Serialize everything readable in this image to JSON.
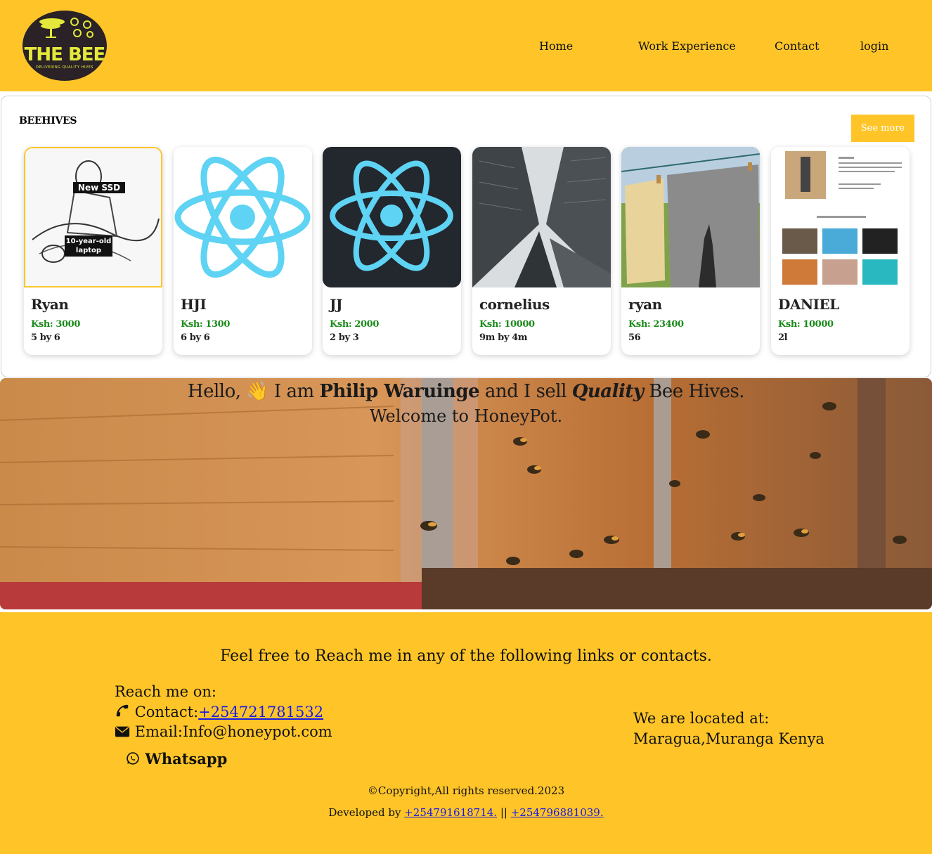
{
  "header": {
    "logo_text": "THE BEE",
    "logo_subtext": "DELIVERING QUALITY HIVES",
    "nav": [
      "Home",
      "Work Experience",
      "Contact",
      "login"
    ]
  },
  "hives": {
    "title": "BEEHIVES",
    "see_more_label": "See more",
    "thumb_text": {
      "badge": "New SSD",
      "caption": "10-year-old laptop"
    },
    "cards": [
      {
        "name": "Ryan",
        "price": "Ksh: 3000",
        "size": "5 by 6",
        "thumb": "sketch-illustration"
      },
      {
        "name": "HJI",
        "price": "Ksh: 1300",
        "size": "6 by 6",
        "thumb": "react-logo-light"
      },
      {
        "name": "JJ",
        "price": "Ksh: 2000",
        "size": "2 by 3",
        "thumb": "react-logo-dark"
      },
      {
        "name": "cornelius",
        "price": "Ksh: 10000",
        "size": "9m by 4m",
        "thumb": "skyscrapers-photo"
      },
      {
        "name": "ryan",
        "price": "Ksh: 23400",
        "size": "56",
        "thumb": "laundry-photo"
      },
      {
        "name": "DANIEL",
        "price": "Ksh: 10000",
        "size": "2l",
        "thumb": "website-screenshot"
      }
    ]
  },
  "hero": {
    "hello": "Hello,",
    "wave_emoji": "👋",
    "i_am": "I am",
    "owner": "Philip Waruinge",
    "and_sell": "and I sell",
    "quality": "Quality",
    "bee_hives": "Bee Hives.",
    "welcome": "Welcome to HoneyPot."
  },
  "footer": {
    "intro": "Feel free to Reach me in any of the following links or contacts.",
    "reach": "Reach me on:",
    "contact_label": "Contact:",
    "contact_phone": "+254721781532",
    "email_label": "Email:Info@honeypot.com",
    "whatsapp": "Whatsapp",
    "location_label": "We are located at:",
    "location_value": "Maragua,Muranga Kenya",
    "copyright": "©Copyright,All rights reserved.2023",
    "developed_by": "Developed by",
    "dev_phone_1": "+254791618714.",
    "separator": "||",
    "dev_phone_2": "+254796881039."
  }
}
